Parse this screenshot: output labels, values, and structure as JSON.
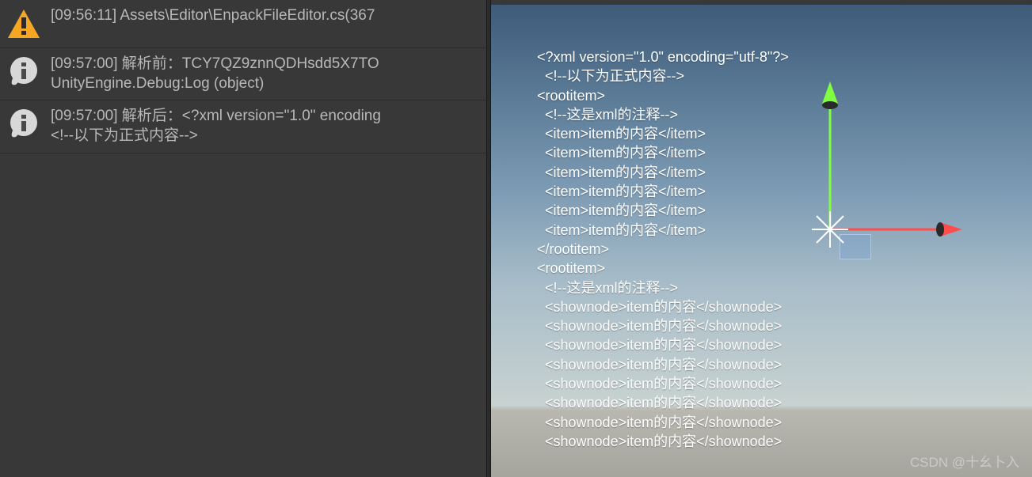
{
  "console": {
    "entries": [
      {
        "kind": "warning",
        "line1": "[09:56:11] Assets\\Editor\\EnpackFileEditor.cs(367",
        "line2": ""
      },
      {
        "kind": "info",
        "line1": "[09:57:00] 解析前：TCY7QZ9znnQDHsdd5X7TO",
        "line2": "UnityEngine.Debug:Log (object)"
      },
      {
        "kind": "info",
        "line1": "[09:57:00] 解析后：<?xml version=\"1.0\" encoding",
        "line2": "  <!--以下为正式内容-->"
      }
    ]
  },
  "scene": {
    "overlay_lines": [
      "<?xml version=\"1.0\" encoding=\"utf-8\"?>",
      "  <!--以下为正式内容-->",
      "<rootitem>",
      "  <!--这是xml的注释-->",
      "  <item>item的内容</item>",
      "  <item>item的内容</item>",
      "  <item>item的内容</item>",
      "  <item>item的内容</item>",
      "  <item>item的内容</item>",
      "  <item>item的内容</item>",
      "</rootitem>",
      "<rootitem>",
      "  <!--这是xml的注释-->",
      "  <shownode>item的内容</shownode>",
      "  <shownode>item的内容</shownode>",
      "  <shownode>item的内容</shownode>",
      "  <shownode>item的内容</shownode>",
      "  <shownode>item的内容</shownode>",
      "  <shownode>item的内容</shownode>",
      "  <shownode>item的内容</shownode>",
      "  <shownode>item的内容</shownode>"
    ],
    "watermark": "CSDN @十幺卜入"
  }
}
